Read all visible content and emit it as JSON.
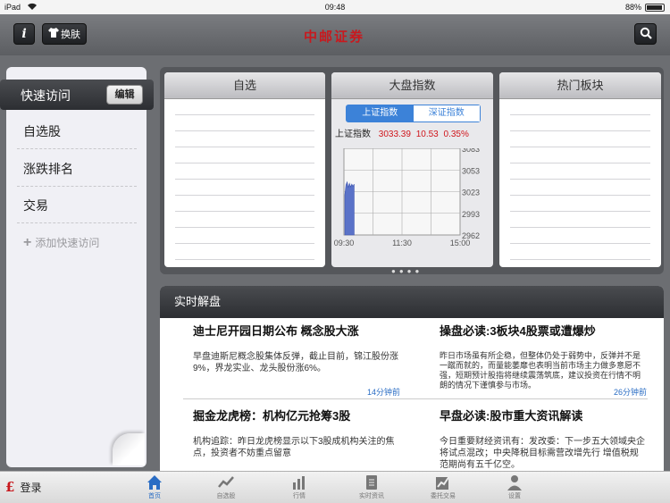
{
  "status_bar": {
    "device": "iPad",
    "time": "09:48",
    "battery": "88%"
  },
  "header": {
    "skin_label": "换肤",
    "logo_text": "中邮证券"
  },
  "quick_access": {
    "title": "快速访问",
    "edit_label": "编辑",
    "items": [
      "自选股",
      "涨跌排名",
      "交易"
    ],
    "add_label": "添加快速访问"
  },
  "panels": {
    "watchlist_title": "自选",
    "index_title": "大盘指数",
    "hot_title": "热门板块"
  },
  "index_widget": {
    "tabs": [
      "上证指数",
      "深证指数"
    ],
    "name": "上证指数",
    "value": "3033.39",
    "change": "10.53",
    "change_pct": "0.35%"
  },
  "chart_data": {
    "type": "line",
    "title": "",
    "x_ticks": [
      "09:30",
      "11:30",
      "15:00"
    ],
    "y_ticks": [
      "3083",
      "3053",
      "3023",
      "2993",
      "2962"
    ],
    "ylim": [
      2962,
      3083
    ],
    "series": [
      {
        "x": [
          "09:30",
          "09:31",
          "09:32",
          "09:33",
          "09:34",
          "09:35",
          "09:36",
          "09:37",
          "09:38"
        ],
        "values": [
          3018,
          3032,
          3036,
          3028,
          3034,
          3029,
          3033,
          3030,
          3033
        ]
      }
    ]
  },
  "news": {
    "title": "实时解盘",
    "items": [
      {
        "title": "迪士尼开园日期公布 概念股大涨",
        "summary": "早盘迪斯尼概念股集体反弹，截止目前，锦江股份涨9%，界龙实业、龙头股份涨6%。",
        "time": "14分钟前"
      },
      {
        "title": "操盘必读:3板块4股票或遭爆炒",
        "summary": "昨日市场虽有所企稳，但整体仍处于弱势中，反弹并不是一蹴而就的，而量能萎靡也表明当前市场主力做多意愿不强，短期预计股指将继续震荡筑底，建议投资在行情不明朗的情况下谨慎参与市场。",
        "time": "26分钟前"
      },
      {
        "title": "掘金龙虎榜：机构亿元抢筹3股",
        "summary": "机构追踪：昨日龙虎榜显示以下3股成机构关注的焦点，投资者不妨重点留意",
        "time": ""
      },
      {
        "title": "早盘必读:股市重大资讯解读",
        "summary": "今日重要财经资讯有：发改委：下一步五大领域央企将试点混改；中央降税目标需营改增先行 增值税规范期尚有五千亿空。",
        "time": ""
      }
    ]
  },
  "tabbar": {
    "login_label": "登录",
    "tabs": [
      "首页",
      "自选股",
      "行情",
      "实时资讯",
      "委托交易",
      "设置"
    ]
  }
}
